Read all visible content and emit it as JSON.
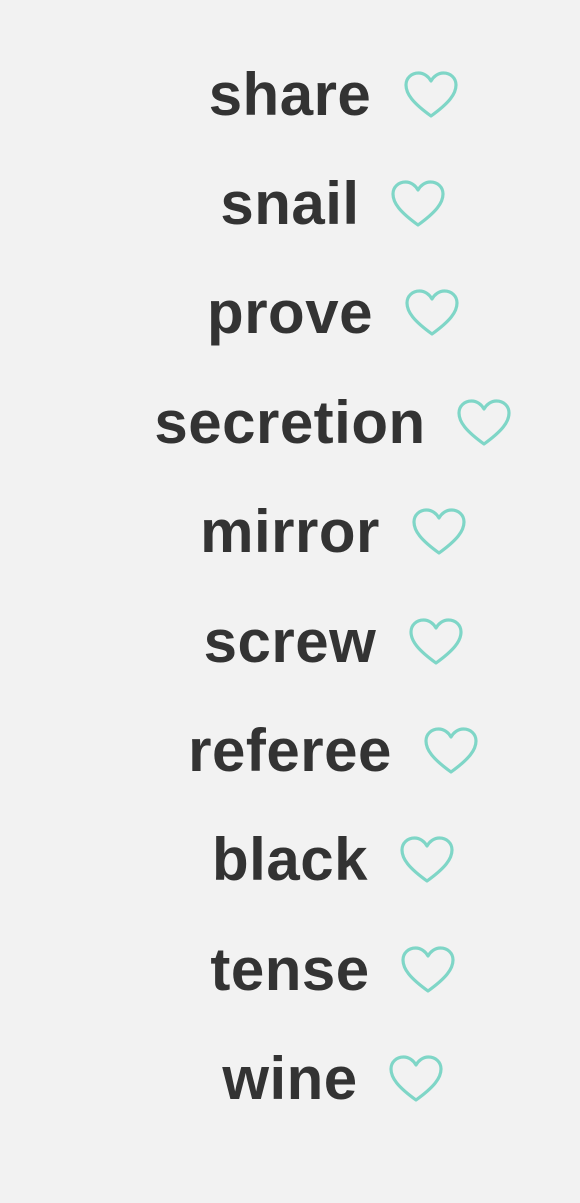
{
  "accent_color": "#7fd6c7",
  "text_color": "#333333",
  "background_color": "#f2f2f2",
  "words": [
    {
      "label": "share",
      "icon": "heart-outline-icon"
    },
    {
      "label": "snail",
      "icon": "heart-outline-icon"
    },
    {
      "label": "prove",
      "icon": "heart-outline-icon"
    },
    {
      "label": "secretion",
      "icon": "heart-outline-icon"
    },
    {
      "label": "mirror",
      "icon": "heart-outline-icon"
    },
    {
      "label": "screw",
      "icon": "heart-outline-icon"
    },
    {
      "label": "referee",
      "icon": "heart-outline-icon"
    },
    {
      "label": "black",
      "icon": "heart-outline-icon"
    },
    {
      "label": "tense",
      "icon": "heart-outline-icon"
    },
    {
      "label": "wine",
      "icon": "heart-outline-icon"
    }
  ]
}
